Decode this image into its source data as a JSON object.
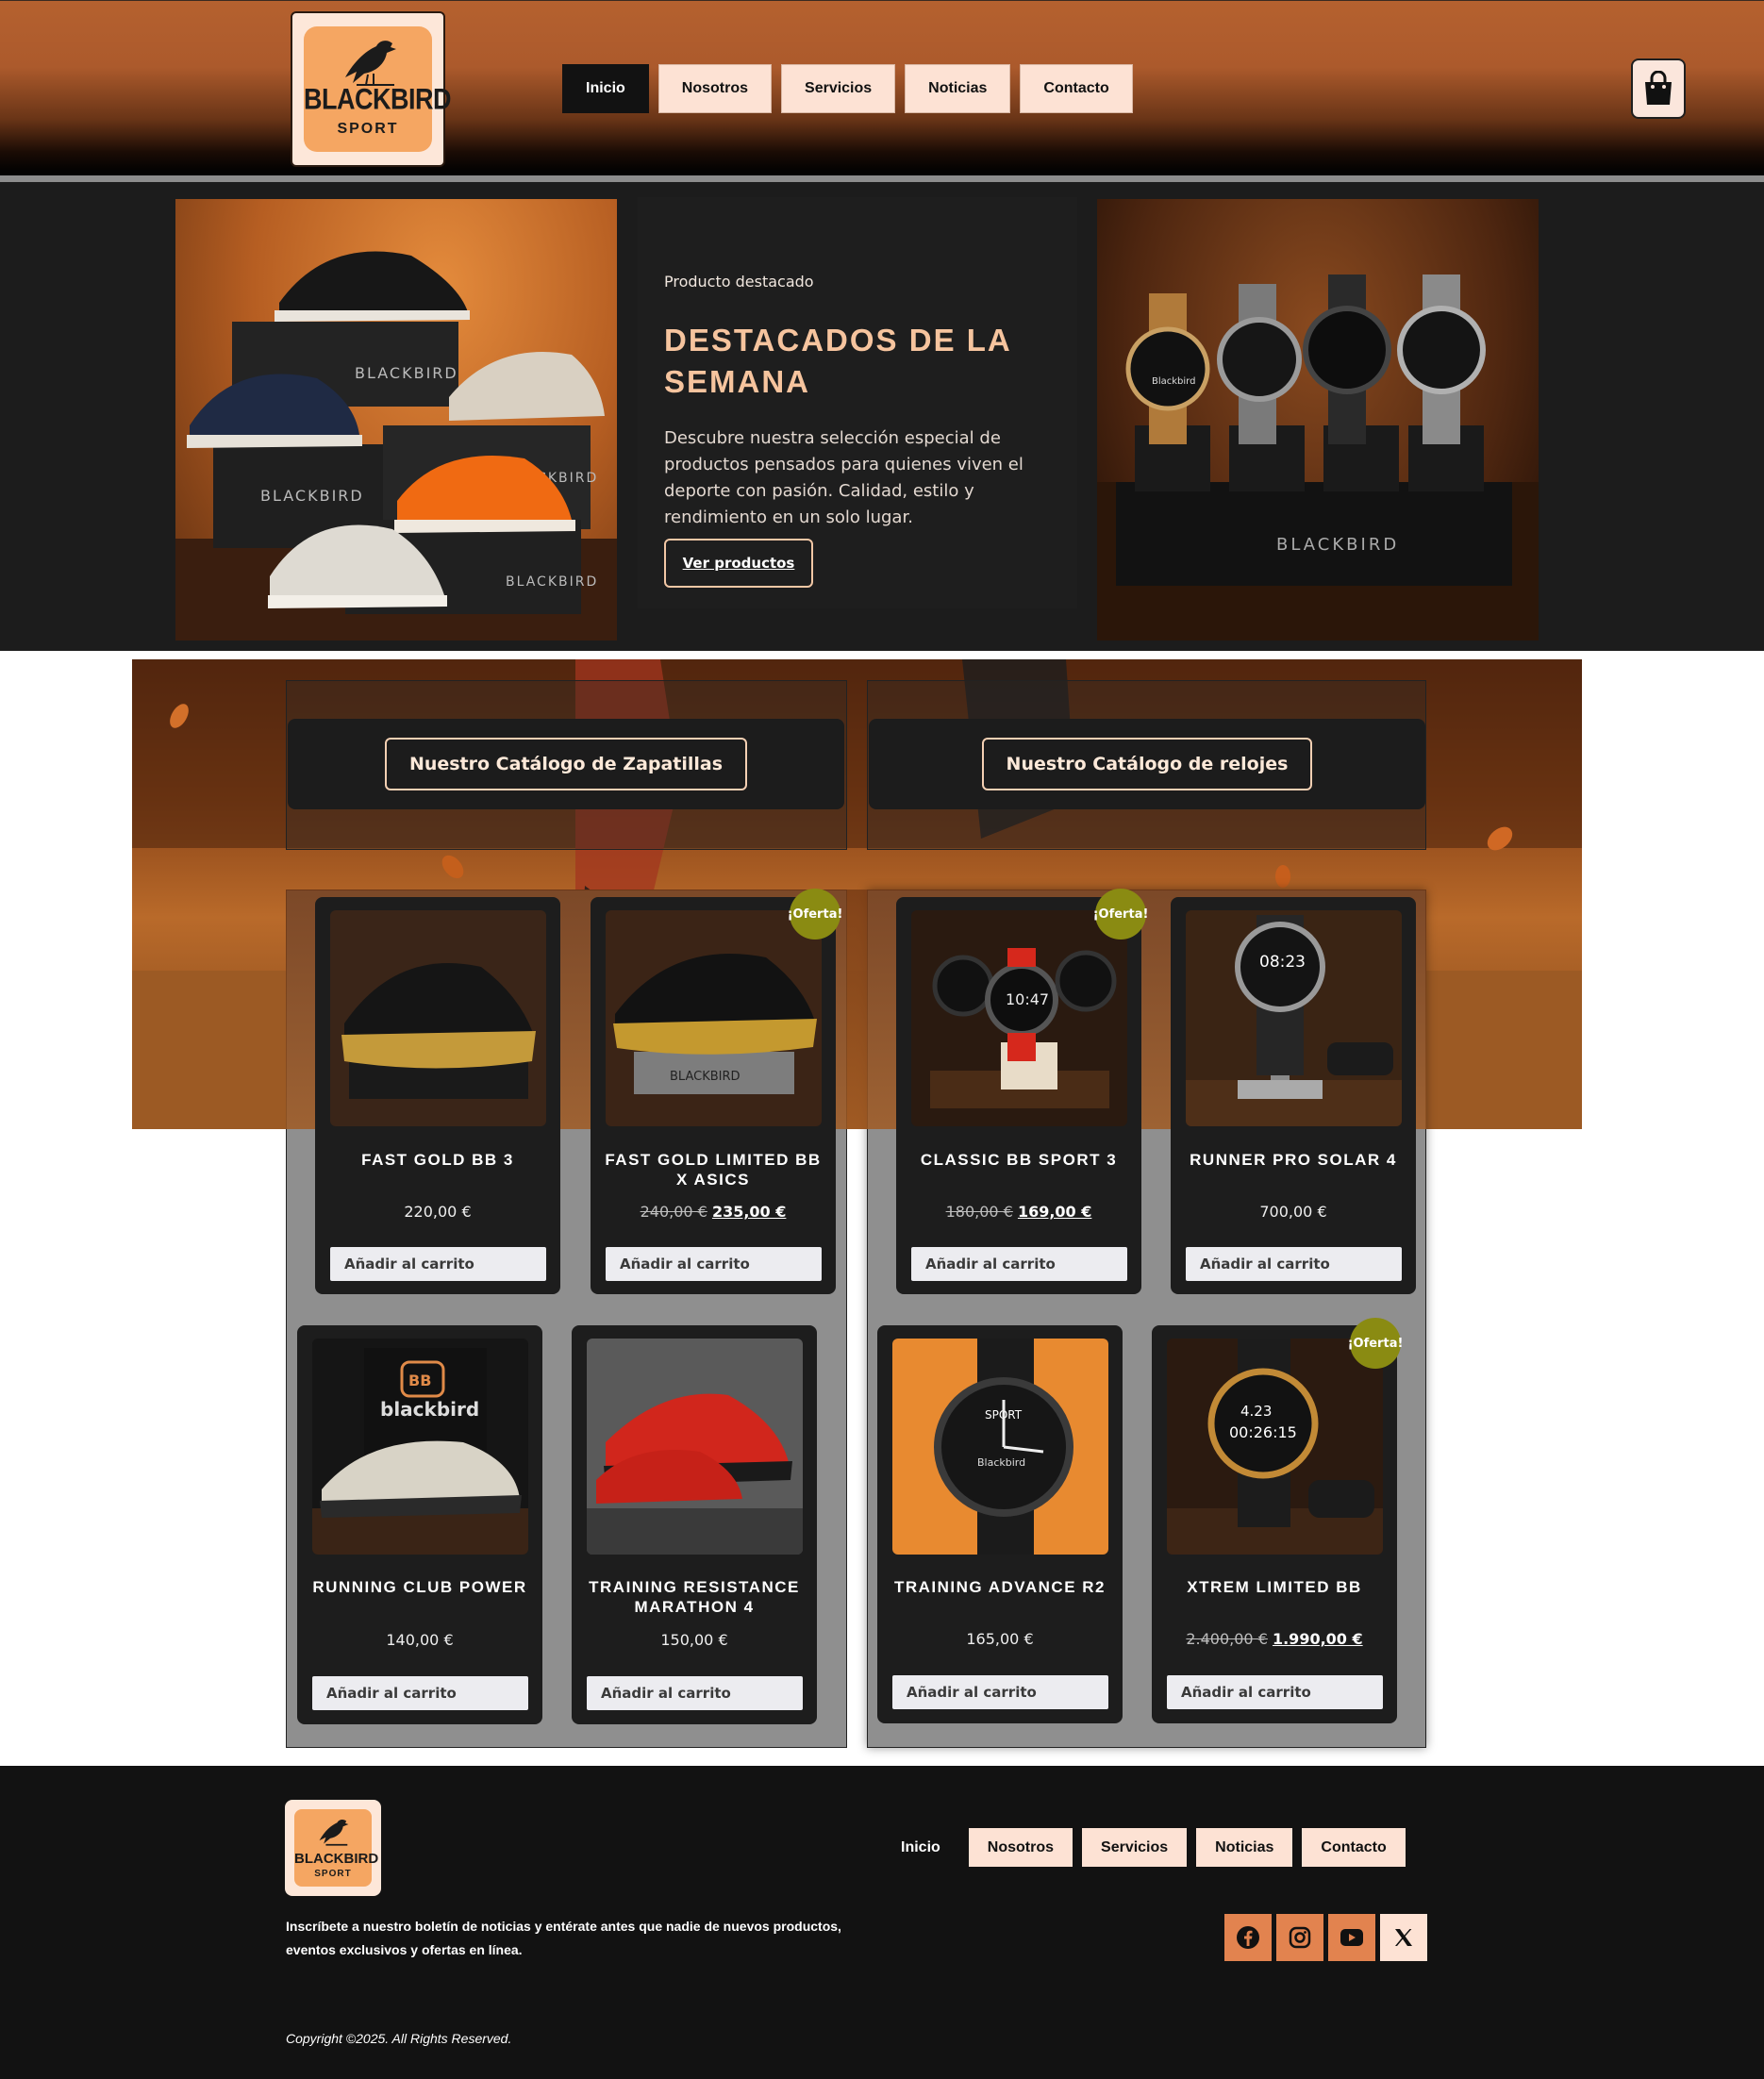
{
  "brand": {
    "logo_line1": "BLACKBIRD",
    "logo_line2": "SPORT"
  },
  "nav": [
    {
      "label": "Inicio",
      "active": true
    },
    {
      "label": "Nosotros",
      "active": false
    },
    {
      "label": "Servicios",
      "active": false
    },
    {
      "label": "Noticias",
      "active": false
    },
    {
      "label": "Contacto",
      "active": false
    }
  ],
  "hero": {
    "kicker": "Producto destacado",
    "title": "DESTACADOS DE LA SEMANA",
    "text": "Descubre nuestra selección especial de productos pensados para quienes viven el deporte con pasión. Calidad, estilo y rendimiento en un solo lugar.",
    "button": "Ver productos"
  },
  "catalogs": {
    "shoes_title": "Nuestro Catálogo de Zapatillas",
    "watches_title": "Nuestro Catálogo de relojes"
  },
  "add_label": "Añadir al carrito",
  "badge_label": "¡Oferta!",
  "shoes": [
    {
      "name": "FAST GOLD BB 3",
      "price": "220,00 €",
      "old_price": "",
      "sale_price": "",
      "offer": false
    },
    {
      "name": "FAST GOLD LIMITED BB X ASICS",
      "price": "",
      "old_price": "240,00 €",
      "sale_price": "235,00 €",
      "offer": true
    },
    {
      "name": "RUNNING CLUB POWER",
      "price": "140,00 €",
      "old_price": "",
      "sale_price": "",
      "offer": false
    },
    {
      "name": "TRAINING RESISTANCE MARATHON 4",
      "price": "150,00 €",
      "old_price": "",
      "sale_price": "",
      "offer": false
    }
  ],
  "watches": [
    {
      "name": "CLASSIC BB SPORT 3",
      "price": "",
      "old_price": "180,00 €",
      "sale_price": "169,00 €",
      "offer": true
    },
    {
      "name": "RUNNER PRO SOLAR 4",
      "price": "700,00 €",
      "old_price": "",
      "sale_price": "",
      "offer": false
    },
    {
      "name": "TRAINING ADVANCE R2",
      "price": "165,00 €",
      "old_price": "",
      "sale_price": "",
      "offer": false
    },
    {
      "name": "XTREM LIMITED BB",
      "price": "",
      "old_price": "2.400,00 €",
      "sale_price": "1.990,00 €",
      "offer": true
    }
  ],
  "footer": {
    "newsletter": "Inscríbete a nuestro boletín de noticias y entérate antes que nadie de nuevos productos, eventos exclusivos y ofertas en línea.",
    "copyright": "Copyright ©2025. All Rights Reserved.",
    "social_icons": [
      "facebook-icon",
      "instagram-icon",
      "youtube-icon",
      "x-icon"
    ]
  },
  "colors": {
    "accent": "#f5a662",
    "nav_bg": "#fde2d4",
    "dark": "#1c1c1c",
    "offer_badge": "#8a8b12",
    "social": "#e2834f"
  }
}
